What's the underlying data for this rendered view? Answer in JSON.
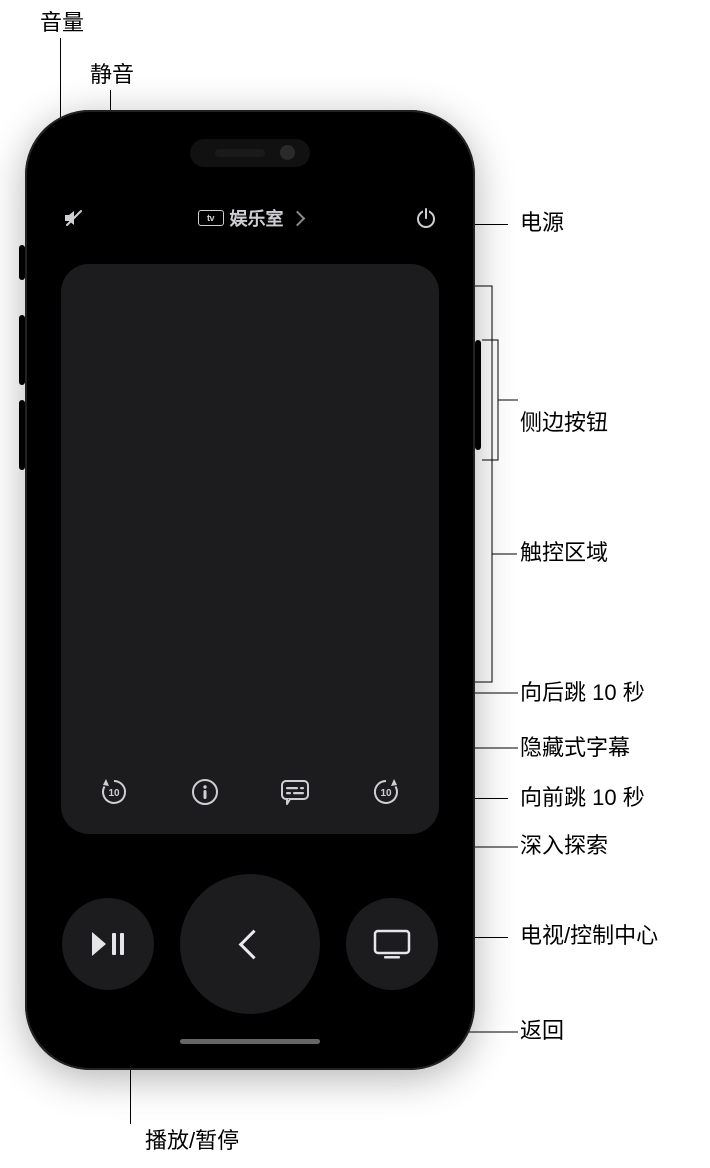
{
  "callouts": {
    "volume": "音量",
    "mute": "静音",
    "power": "电源",
    "side_button": "侧边按钮",
    "touch_area": "触控区域",
    "skip_back_10": "向后跳 10 秒",
    "closed_captions": "隐藏式字幕",
    "skip_fwd_10": "向前跳 10 秒",
    "explore": "深入探索",
    "tv_control_center": "电视/控制中心",
    "back": "返回",
    "play_pause": "播放/暂停"
  },
  "header": {
    "device_name": "娱乐室",
    "logo_text": "tv"
  },
  "icons": {
    "mute": "mute-icon",
    "power": "power-icon",
    "skip_back": "skip-back-10-icon",
    "info": "info-icon",
    "captions": "captions-icon",
    "skip_fwd": "skip-forward-10-icon",
    "play_pause": "play-pause-icon",
    "back": "back-icon",
    "tv": "tv-icon"
  },
  "skip_seconds": "10",
  "colors": {
    "phone_bg": "#000000",
    "pad_bg": "#1c1c1e",
    "icon": "#cfcfd3"
  }
}
